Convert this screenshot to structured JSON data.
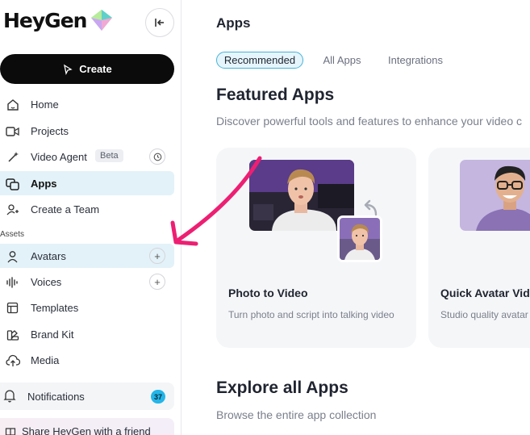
{
  "brand": {
    "name": "HeyGen",
    "accent": "#ed1f73"
  },
  "sidebar": {
    "create_label": "Create",
    "items": [
      {
        "label": "Home",
        "icon": "home-icon"
      },
      {
        "label": "Projects",
        "icon": "video-camera-icon"
      },
      {
        "label": "Video Agent",
        "icon": "magic-wand-icon",
        "badge": "Beta"
      },
      {
        "label": "Apps",
        "icon": "apps-icon",
        "active": true
      },
      {
        "label": "Create a Team",
        "icon": "add-user-icon"
      }
    ],
    "assets_label": "Assets",
    "assets": [
      {
        "label": "Avatars",
        "icon": "person-icon"
      },
      {
        "label": "Voices",
        "icon": "waveform-icon"
      },
      {
        "label": "Templates",
        "icon": "template-icon"
      },
      {
        "label": "Brand Kit",
        "icon": "brand-kit-icon"
      },
      {
        "label": "Media",
        "icon": "upload-cloud-icon"
      }
    ],
    "notifications": {
      "label": "Notifications",
      "count": "37"
    },
    "share_label": "Share HeyGen with a friend"
  },
  "main": {
    "title": "Apps",
    "tabs": [
      {
        "label": "Recommended",
        "active": true
      },
      {
        "label": "All Apps"
      },
      {
        "label": "Integrations"
      }
    ],
    "featured": {
      "heading": "Featured Apps",
      "subtitle": "Discover powerful tools and features to enhance your video c",
      "cards": [
        {
          "title": "Photo to Video",
          "description": "Turn photo and script into talking video"
        },
        {
          "title": "Quick Avatar Vide",
          "description": "Studio quality avatar"
        }
      ]
    },
    "explore": {
      "heading": "Explore all Apps",
      "subtitle": "Browse the entire app collection"
    }
  }
}
